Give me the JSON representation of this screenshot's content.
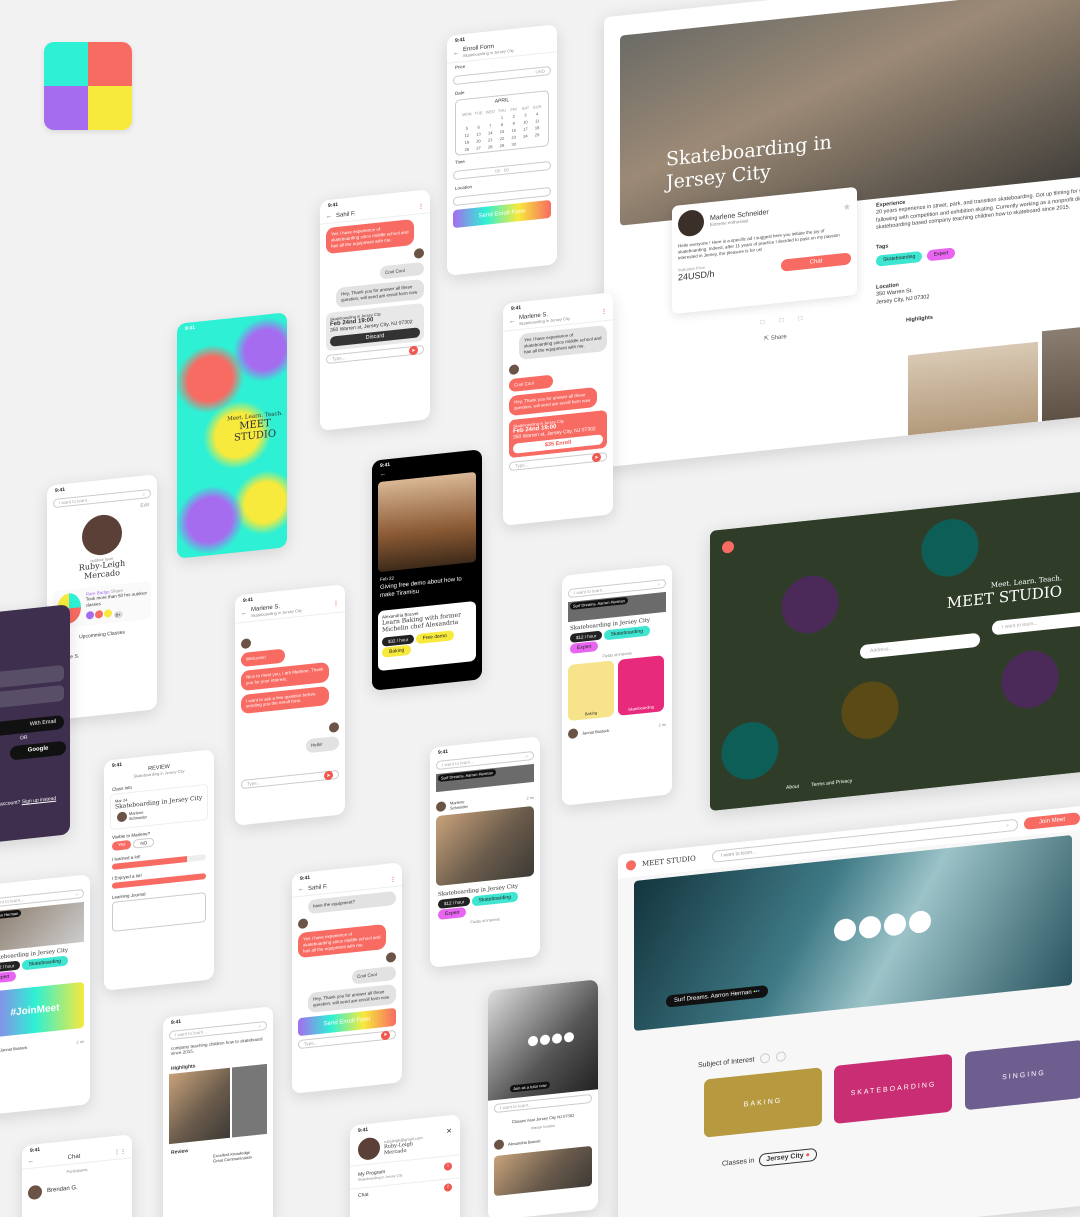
{
  "brand": {
    "name": "MEET STUDIO",
    "tagline": "Meet. Learn. Teach.",
    "colors": {
      "cyan": "#2ef0d4",
      "coral": "#f76b63",
      "purple": "#a66cf0",
      "yellow": "#f7ea3c",
      "accent": "#f0584f"
    }
  },
  "status_time": "9:41",
  "hero": {
    "title_line1": "Skateboarding in",
    "title_line2": "Jersey City",
    "instructor_name": "Marlene Schneider",
    "instructor_role": "Extreme enthusiast",
    "bio": "Hello everyone ! Here is a specific ad I suggest here you initiate the joy of skateboarding. Indeed, after 11 years of practice I decided to pass on my passion interested in Jersey, the pleasure is for us!",
    "price_label": "Indicative Price",
    "price": "24USD/h",
    "chat_button": "Chat",
    "share_button": "Share",
    "experience_label": "Experience",
    "experience_text": "20 years experience in street, park, and transition skateboarding. Got up filming for sponsors fallowing with competition and exhibition skating. Currently working as a nonprofit director for a skateboarding based company teaching children how to skateboard since 2015.",
    "tags_label": "Tags",
    "tags": [
      "Skateboarding",
      "Expert"
    ],
    "location_label": "Location",
    "location_line1": "350 Warren St.",
    "location_line2": "Jersey City, NJ 07302",
    "highlights_label": "Highlights"
  },
  "landing": {
    "tagline": "Meet. Learn. Teach.",
    "title": "MEET STUDIO",
    "address_placeholder": "Address...",
    "learn_placeholder": "I want to learn...",
    "footer_about": "About",
    "footer_terms": "Terms and Privacy"
  },
  "desktop_home": {
    "logo_text": "MEET STUDIO",
    "search_placeholder": "I want to learn...",
    "join_button": "Join Meet",
    "video_caption": "Surf Dreams. Aarron Herman",
    "subject_label": "Subject of Interest",
    "subjects": [
      "BAKING",
      "SKATEBOARDING",
      "SINGING"
    ],
    "classes_in_label": "Classes in",
    "classes_in_city": "Jersey City"
  },
  "enroll": {
    "title": "Enroll Form",
    "subtitle": "Skateboarding in Jersey City",
    "price_label": "Price",
    "currency": "USD",
    "date_label": "Date",
    "month": "APRIL",
    "weekdays": [
      "MON",
      "TUE",
      "WED",
      "THU",
      "FRI",
      "SAT",
      "SUN"
    ],
    "days": [
      "",
      "",
      "",
      "1",
      "2",
      "3",
      "4",
      "5",
      "6",
      "7",
      "8",
      "9",
      "10",
      "11",
      "12",
      "13",
      "14",
      "15",
      "16",
      "17",
      "18",
      "19",
      "20",
      "21",
      "22",
      "23",
      "24",
      "25",
      "26",
      "27",
      "28",
      "29",
      "30"
    ],
    "time_label": "Time",
    "time_value": "00 : 00",
    "location_label": "Location",
    "send_button": "Send Enroll Form"
  },
  "chat_sahil": {
    "name": "Sahil F.",
    "msg1": "Yes I have experience of skateboarding since middle school and has all the equipment with me.",
    "reply1": "Cool Cool",
    "msg2": "Hey, Thank you for answer all these question, will send am enroll form now",
    "card_subtitle": "Skateboarding in Jersey City",
    "card_date": "Feb 24nd 19:00",
    "card_addr": "350 Warren st, Jersey City, NJ 07302",
    "discard_button": "Discard",
    "type_placeholder": "Type..."
  },
  "chat_marlene": {
    "name": "Marlene S.",
    "subtitle": "Skateboarding in Jersey City",
    "msg1": "Yes I have experience of skateboarding since middle school and has all the equipment with me.",
    "reply1": "Cool Cool",
    "msg2": "Hey, Thank you for answer all these question, will send am enroll form now",
    "card_subtitle": "Skateboarding in Jersey City",
    "card_date": "Feb 24nd 19:00",
    "card_addr": "350 Warren st, Jersey City, NJ 07302",
    "enroll_button": "$35 Enroll",
    "type_placeholder": "Type..."
  },
  "splash": {
    "tagline": "Meet. Learn. Teach.",
    "title": "MEET STUDIO"
  },
  "video_phone": {
    "date": "Feb 22",
    "caption": "Giving free demo about how to make Tiramisu",
    "teacher": "Alexandria Bouvet",
    "course": "Learn Baking with former Michelin chef Alexandria",
    "price": "$32 / hour",
    "tag1": "Free demo",
    "tag2": "Baking"
  },
  "profile": {
    "search_placeholder": "I want to learn...",
    "edit": "Edit",
    "role": "outdoor lover",
    "name_line1": "Ruby-Leigh",
    "name_line2": "Mercado",
    "badge_title": "Rare Badge",
    "badge_share": "Share",
    "badge_text": "Took more than 50 hrs outdoor classes",
    "badge_more": "8+",
    "upcoming": "Upcomming Classes",
    "upcoming_date": "Mar 27",
    "upcoming_name": "Marlene S."
  },
  "welcome_chat": {
    "name": "Marlene S.",
    "subtitle": "Skateboarding in Jersey City",
    "msg1": "Welcome!",
    "msg2": "Nice to meet you, I am Marlene, Thank you for your interest.",
    "msg3": "I want to ask a few question before sending you the enroll form.",
    "reply": "Hello!",
    "type_placeholder": "Type..."
  },
  "listing_phone": {
    "search_placeholder": "I want to learn...",
    "video_title": "Surf Dreams. Aarron Herman",
    "course": "Skateboarding in Jersey City",
    "price": "$12 / hour",
    "tag1": "Skateboarding",
    "tag2": "Expert",
    "fields_label": "Fields of interest",
    "field1": "Baking",
    "field2": "Skateboarding",
    "person": "Jannat Bostock",
    "time": "2 mi"
  },
  "review": {
    "title": "REVIEW",
    "subtitle": "Skateboarding in Jersey City",
    "class_info": "Class Info",
    "date": "Mar 24",
    "course": "Skateboarding in Jersey City",
    "teacher": "Marlene Schneider",
    "visible_q": "Visible to Marlene?",
    "yes": "Yes",
    "no": "NO",
    "learned": "I learned a lot!",
    "enjoyed": "I Enjoyed a lot!",
    "journal": "Learning Journal"
  },
  "sahil2": {
    "name": "Sahil F.",
    "msg0": "have the equipment?",
    "msg1": "Yes I have experience of skateboarding since middle school and has all the equipment with me.",
    "reply": "Cool Cool",
    "msg2": "Hey, Thank you for answer all these question, will send am enroll form now",
    "send": "Send Enroll Form",
    "type_placeholder": "Type..."
  },
  "marlene_listing": {
    "search_placeholder": "I want to learn...",
    "video_title": "Surf Dreams. Aarron Herman",
    "teacher": "Marlene Schneider",
    "time": "2 mi",
    "course": "Skateboarding in Jersey City",
    "price": "$12 / hour",
    "tag1": "Skateboarding",
    "tag2": "Expert",
    "fields_label": "Fields of interest"
  },
  "login": {
    "with_email": "With Email",
    "or": "OR",
    "google": "Google",
    "account": "account?",
    "signup": "Sign up instead"
  },
  "left_list": {
    "search_placeholder": "I want to learn...",
    "video_title": "Aarron Herman",
    "course": "Skateboarding in Jersey City",
    "price": "$12 / hour",
    "tag1": "Skateboarding",
    "tag2": "Expert",
    "banner": "#JoinMeet",
    "person": "Jannat Bostock",
    "time": "2 mi"
  },
  "highlights_phone": {
    "search_placeholder": "I want to learn...",
    "text": "company teaching children how to skateboard since 2015.",
    "highlights": "Highlights",
    "review": "Review",
    "rev1": "Excellent Knowledge",
    "rev2": "Great Communication"
  },
  "guitar_phone": {
    "join_text": "Join as a tutor now",
    "search_placeholder": "I want to learn...",
    "classes_text": "Classes near Jersey City NJ 07302",
    "change": "change location",
    "person": "Alexandria Bouvet"
  },
  "account_phone": {
    "email": "rubyleigh@gmail.com",
    "name_line1": "Ruby-Leigh",
    "name_line2": "Mercado",
    "program": "My Program",
    "program_sub": "Skateboarding in Jersey City",
    "chat": "Chat",
    "badge1": "1",
    "badge2": "2"
  },
  "chat_list": {
    "title": "Chat",
    "participants": "Participants",
    "name": "Brendan G."
  }
}
